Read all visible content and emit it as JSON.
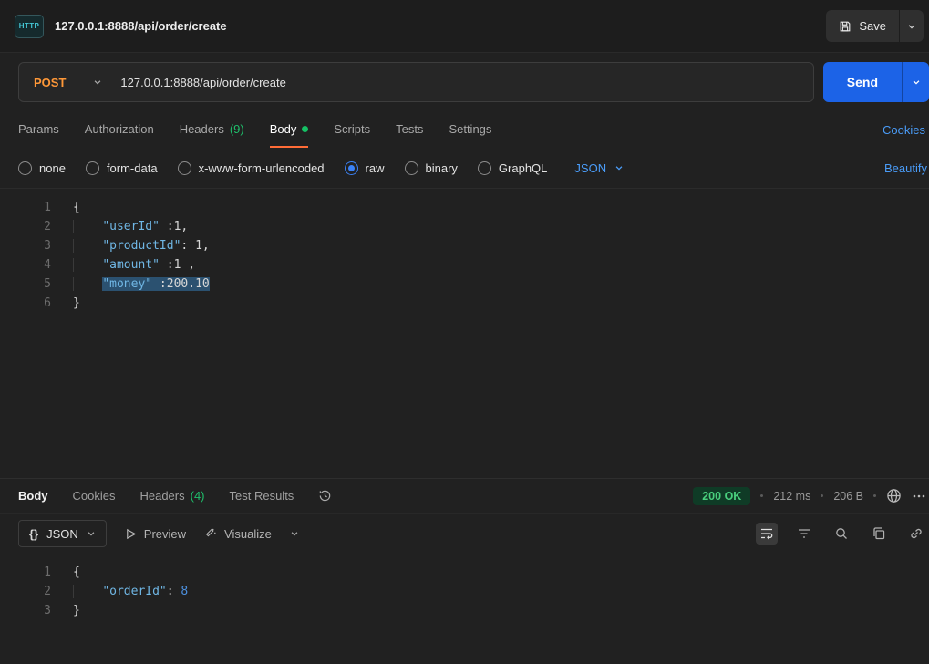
{
  "header": {
    "badge": "HTTP",
    "title": "127.0.0.1:8888/api/order/create",
    "save_label": "Save"
  },
  "request": {
    "method": "POST",
    "url": "127.0.0.1:8888/api/order/create",
    "send_label": "Send"
  },
  "request_tabs": {
    "items": [
      {
        "label": "Params",
        "active": false
      },
      {
        "label": "Authorization",
        "active": false
      },
      {
        "label": "Headers",
        "count": "(9)",
        "active": false
      },
      {
        "label": "Body",
        "active": true,
        "dot": true
      },
      {
        "label": "Scripts",
        "active": false
      },
      {
        "label": "Tests",
        "active": false
      },
      {
        "label": "Settings",
        "active": false
      }
    ],
    "cookies_link": "Cookies"
  },
  "body_type": {
    "options": [
      {
        "label": "none",
        "selected": false
      },
      {
        "label": "form-data",
        "selected": false
      },
      {
        "label": "x-www-form-urlencoded",
        "selected": false
      },
      {
        "label": "raw",
        "selected": true
      },
      {
        "label": "binary",
        "selected": false
      },
      {
        "label": "GraphQL",
        "selected": false
      }
    ],
    "format": "JSON",
    "beautify_link": "Beautify"
  },
  "request_editor": {
    "lines": [
      {
        "num": "1",
        "tokens": [
          {
            "t": "{",
            "c": "punct"
          }
        ]
      },
      {
        "num": "2",
        "tokens": [
          {
            "t": "    ",
            "c": "ws"
          },
          {
            "t": "\"userId\"",
            "c": "key"
          },
          {
            "t": " :",
            "c": "punct"
          },
          {
            "t": "1",
            "c": "num"
          },
          {
            "t": ",",
            "c": "punct"
          }
        ]
      },
      {
        "num": "3",
        "tokens": [
          {
            "t": "    ",
            "c": "ws"
          },
          {
            "t": "\"productId\"",
            "c": "key"
          },
          {
            "t": ": ",
            "c": "punct"
          },
          {
            "t": "1",
            "c": "num"
          },
          {
            "t": ",",
            "c": "punct"
          }
        ]
      },
      {
        "num": "4",
        "tokens": [
          {
            "t": "    ",
            "c": "ws"
          },
          {
            "t": "\"amount\"",
            "c": "key"
          },
          {
            "t": " :",
            "c": "punct"
          },
          {
            "t": "1",
            "c": "num"
          },
          {
            "t": " ,",
            "c": "punct"
          }
        ]
      },
      {
        "num": "5",
        "tokens": [
          {
            "t": "    ",
            "c": "ws"
          },
          {
            "t": "\"money\"",
            "c": "key",
            "sel": true
          },
          {
            "t": " :",
            "c": "punct",
            "sel": true
          },
          {
            "t": "200.10",
            "c": "num",
            "sel": true
          }
        ]
      },
      {
        "num": "6",
        "tokens": [
          {
            "t": "}",
            "c": "punct"
          }
        ]
      }
    ]
  },
  "response": {
    "tabs": [
      {
        "label": "Body",
        "active": true
      },
      {
        "label": "Cookies",
        "active": false
      },
      {
        "label": "Headers",
        "count": "(4)",
        "active": false
      },
      {
        "label": "Test Results",
        "active": false
      }
    ],
    "status": "200 OK",
    "time": "212 ms",
    "size": "206 B",
    "toolbar": {
      "format_icon": "{}",
      "format_label": "JSON",
      "preview_label": "Preview",
      "visualize_label": "Visualize"
    },
    "editor": {
      "lines": [
        {
          "num": "1",
          "tokens": [
            {
              "t": "{",
              "c": "punct"
            }
          ]
        },
        {
          "num": "2",
          "tokens": [
            {
              "t": "    ",
              "c": "ws"
            },
            {
              "t": "\"orderId\"",
              "c": "key"
            },
            {
              "t": ": ",
              "c": "punct"
            },
            {
              "t": "8",
              "c": "value"
            }
          ]
        },
        {
          "num": "3",
          "tokens": [
            {
              "t": "}",
              "c": "punct"
            }
          ]
        }
      ]
    }
  },
  "icons": {
    "save": "floppy-disk",
    "chevron": "chevron-down",
    "history": "clock-history",
    "globe": "globe",
    "more": "kebab-dots",
    "wrap": "wrap-text",
    "filter": "filter-lines",
    "search": "magnifier",
    "copy": "copy-squares",
    "link": "link",
    "preview": "play-triangle",
    "visualize": "sparkle-wand"
  },
  "colors": {
    "accent_orange": "#ff6c37",
    "method_post_orange": "#ff9838",
    "link_blue": "#4a9cf8",
    "count_green": "#1fbf6b",
    "status_green": "#49cf7d",
    "send_button_blue": "#1c63e7",
    "selection_blue": "#2b5170",
    "json_key_blue": "#70b7e5"
  }
}
